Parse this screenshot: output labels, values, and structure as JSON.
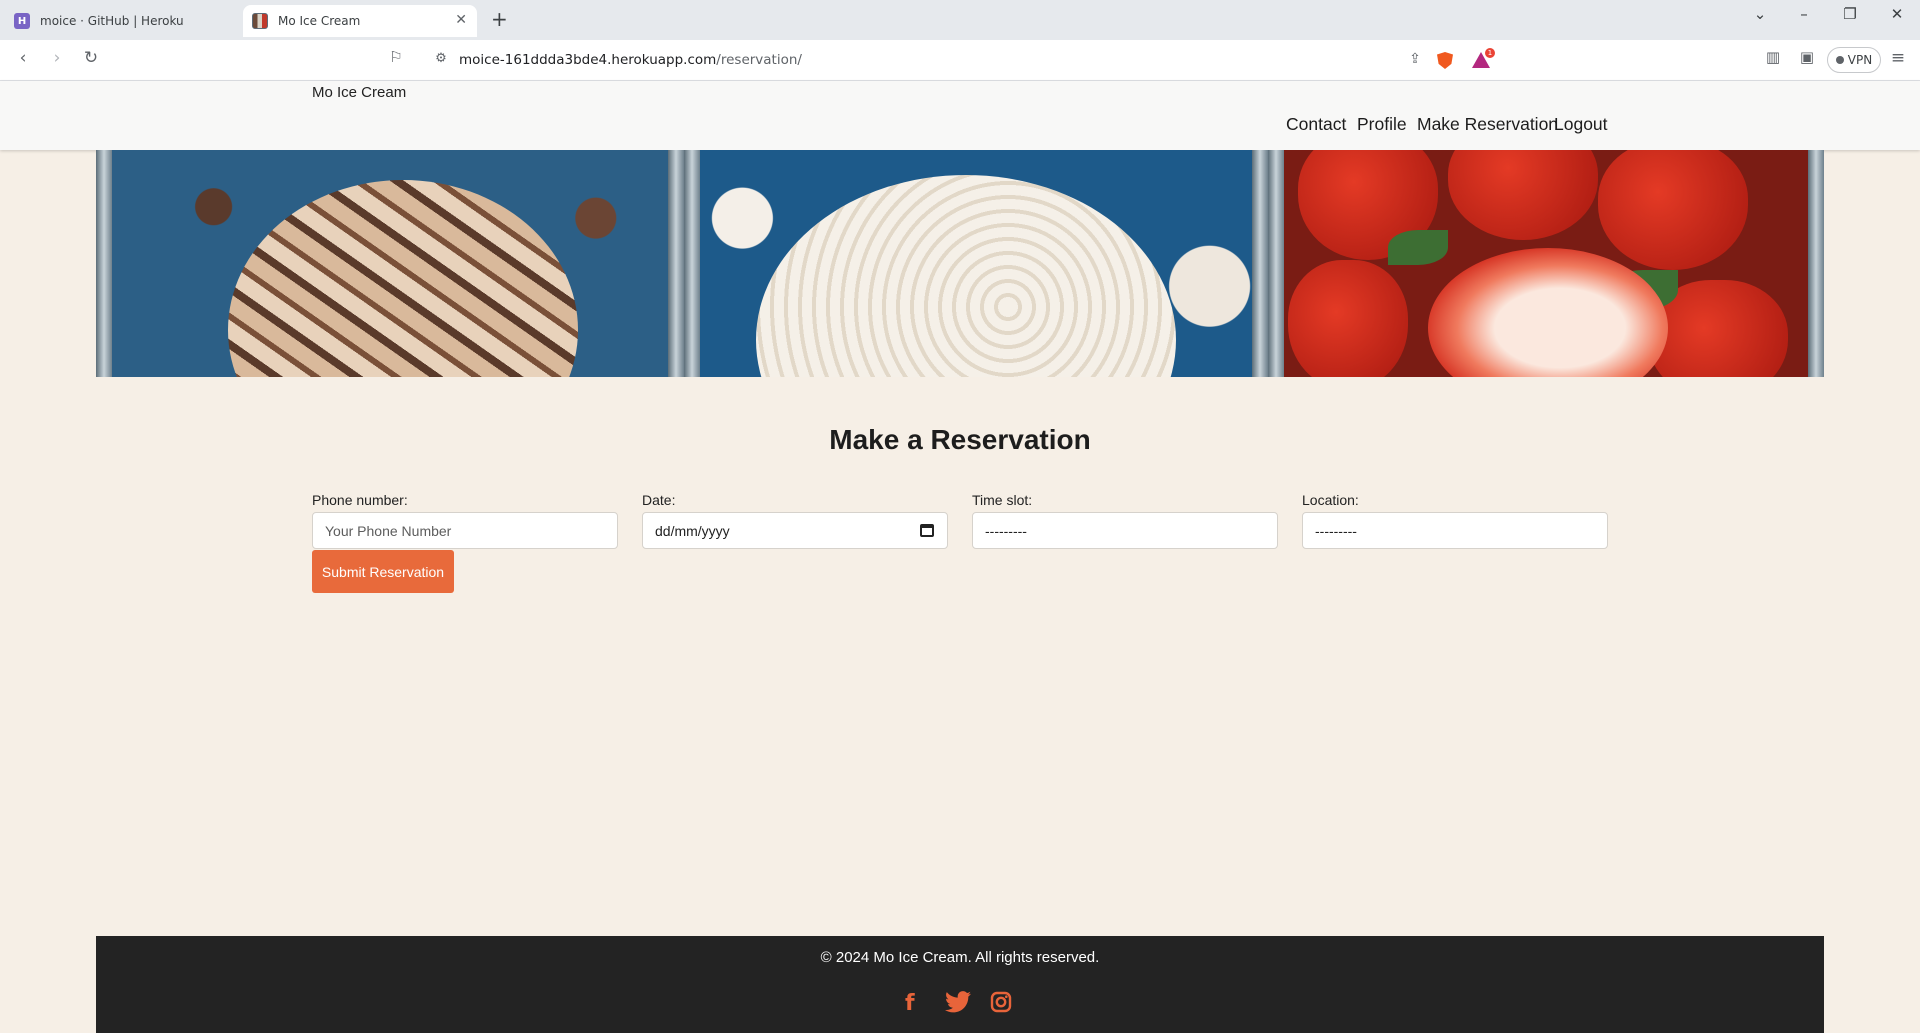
{
  "browser": {
    "tabs": [
      {
        "title": "moice · GitHub | Heroku",
        "favicon": "H",
        "active": false
      },
      {
        "title": "Mo Ice Cream",
        "favicon": "",
        "active": true
      }
    ],
    "url_host": "moice-161ddda3bde4.herokuapp.com",
    "url_path": "/reservation/",
    "vpn_label": "VPN",
    "rewards_badge": "1"
  },
  "header": {
    "brand": "Mo Ice Cream",
    "nav": [
      "Contact",
      "Profile",
      "Make Reservation",
      "Logout"
    ]
  },
  "form": {
    "title": "Make a Reservation",
    "phone_label": "Phone number:",
    "phone_placeholder": "Your Phone Number",
    "date_label": "Date:",
    "date_value": "dd/mm/yyyy",
    "time_label": "Time slot:",
    "time_value": "---------",
    "location_label": "Location:",
    "location_value": "---------",
    "submit_label": "Submit Reservation"
  },
  "footer": {
    "copyright": "© 2024 Mo Ice Cream. All rights reserved.",
    "social_icons": [
      "facebook-icon",
      "twitter-icon",
      "instagram-icon"
    ]
  },
  "colors": {
    "page_background": "#f6efe6",
    "accent": "#e86a3b",
    "footer_background": "#232323"
  }
}
